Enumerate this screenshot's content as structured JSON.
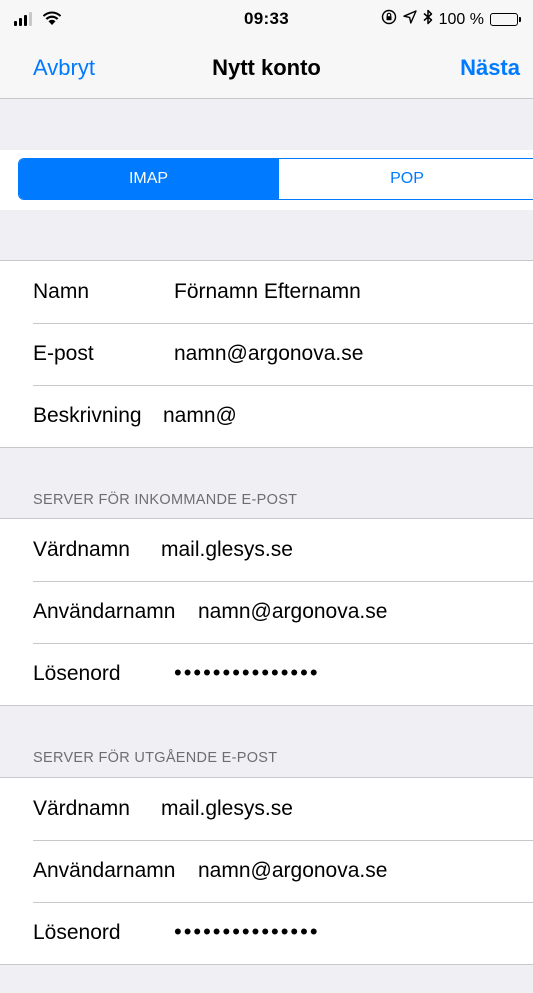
{
  "status_bar": {
    "time": "09:33",
    "battery_text": "100 %",
    "icons": [
      "signal-icon",
      "wifi-icon",
      "orientation-lock-icon",
      "location-icon",
      "bluetooth-icon",
      "battery-icon"
    ]
  },
  "nav": {
    "left": "Avbryt",
    "title": "Nytt konto",
    "right": "Nästa"
  },
  "segmented": {
    "options": [
      "IMAP",
      "POP"
    ],
    "selected": "IMAP"
  },
  "account": [
    {
      "label": "Namn",
      "value": "Förnamn Efternamn"
    },
    {
      "label": "E-post",
      "value": "namn@argonova.se"
    },
    {
      "label": "Beskrivning",
      "value": "namn@"
    }
  ],
  "incoming": {
    "header": "SERVER FÖR INKOMMANDE E-POST",
    "rows": [
      {
        "label": "Värdnamn",
        "value": "mail.glesys.se"
      },
      {
        "label": "Användarnamn",
        "value": "namn@argonova.se"
      },
      {
        "label": "Lösenord",
        "value": "•••••••••••••••"
      }
    ]
  },
  "outgoing": {
    "header": "SERVER FÖR UTGÅENDE E-POST",
    "rows": [
      {
        "label": "Värdnamn",
        "value": "mail.glesys.se"
      },
      {
        "label": "Användarnamn",
        "value": "namn@argonova.se"
      },
      {
        "label": "Lösenord",
        "value": "•••••••••••••••"
      }
    ]
  },
  "colors": {
    "accent": "#007aff",
    "background": "#efeff4",
    "separator": "#c8c7cc",
    "section_text": "#6d6d72"
  }
}
